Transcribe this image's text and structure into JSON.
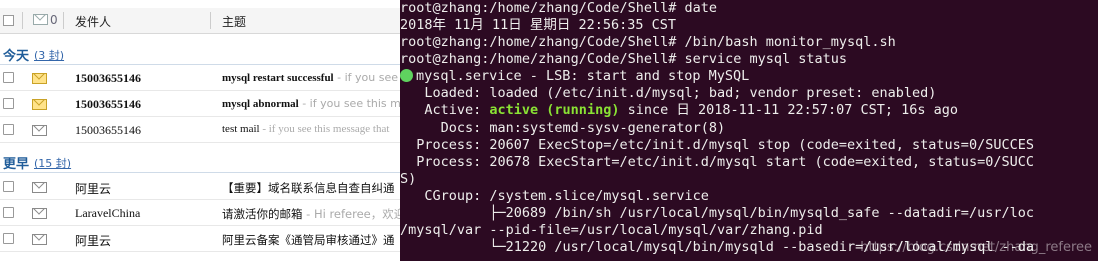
{
  "mail": {
    "header": {
      "attach_mark": "0",
      "col_sender": "发件人",
      "col_subject": "主题"
    },
    "groups": [
      {
        "title": "今天",
        "count": "(3 封)"
      },
      {
        "title": "更早",
        "count": "(15 封)"
      }
    ],
    "today_rows": [
      {
        "sender": "15003655146",
        "subject": "mysql restart successful",
        "preview": " - if you see this message",
        "unread": true
      },
      {
        "sender": "15003655146",
        "subject": "mysql abnormal",
        "preview": " - if you see this message",
        "unread": true
      },
      {
        "sender": "15003655146",
        "subject": "test mail",
        "preview": " - if you see this message that",
        "unread": false
      }
    ],
    "earlier_rows": [
      {
        "sender": "阿里云",
        "subject": "【重要】域名联系信息自查自纠通"
      },
      {
        "sender": "LaravelChina",
        "subject": "请激活你的邮箱",
        "preview": " - Hi referee，欢迎"
      },
      {
        "sender": "阿里云",
        "subject": "阿里云备案《通管局审核通过》通"
      }
    ]
  },
  "terminal": {
    "lines": [
      "root@zhang:/home/zhang/Code/Shell# date",
      "2018年 11月 11日 星期日 22:56:35 CST",
      "root@zhang:/home/zhang/Code/Shell# /bin/bash monitor_mysql.sh",
      "root@zhang:/home/zhang/Code/Shell# service mysql status"
    ],
    "service_line": "mysql.service - LSB: start and stop MySQL",
    "loaded": "   Loaded: loaded (/etc/init.d/mysql; bad; vendor preset: enabled)",
    "active_prefix": "   Active: ",
    "active_state": "active (running)",
    "active_suffix": " since 日 2018-11-11 22:57:07 CST; 16s ago",
    "rest": [
      "     Docs: man:systemd-sysv-generator(8)",
      "  Process: 20607 ExecStop=/etc/init.d/mysql stop (code=exited, status=0/SUCCES",
      "  Process: 20678 ExecStart=/etc/init.d/mysql start (code=exited, status=0/SUCC",
      "S)",
      "   CGroup: /system.slice/mysql.service",
      "           ├─20689 /bin/sh /usr/local/mysql/bin/mysqld_safe --datadir=/usr/loc",
      "/mysql/var --pid-file=/usr/local/mysql/var/zhang.pid",
      "           └─21220 /usr/local/mysql/bin/mysqld --basedir=/usr/local/mysql --da"
    ],
    "watermark": "https://blog.csdn.net/zhang_referee",
    "colors": {
      "bg": "#2c0a22",
      "fg": "#eeeeec",
      "active": "#8ae234"
    }
  }
}
